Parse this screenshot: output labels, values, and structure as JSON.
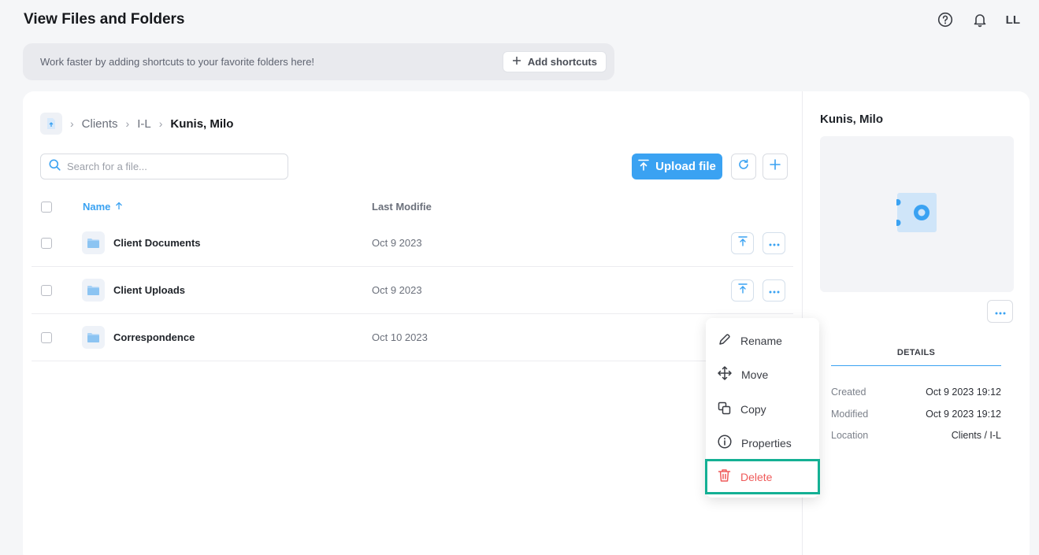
{
  "header": {
    "title": "View Files and Folders",
    "user_initials": "LL",
    "help_icon": "help-circle-icon",
    "bell_icon": "bell-icon"
  },
  "shortcuts": {
    "message": "Work faster by adding shortcuts to your favorite folders here!",
    "button_label": "Add shortcuts"
  },
  "breadcrumb": {
    "items": [
      "Clients",
      "I-L"
    ],
    "current": "Kunis, Milo"
  },
  "search": {
    "placeholder": "Search for a file..."
  },
  "toolbar": {
    "upload_label": "Upload file"
  },
  "table": {
    "columns": {
      "name": "Name",
      "modified": "Last Modifie"
    },
    "rows": [
      {
        "name": "Client Documents",
        "modified": "Oct 9 2023"
      },
      {
        "name": "Client Uploads",
        "modified": "Oct 9 2023"
      },
      {
        "name": "Correspondence",
        "modified": "Oct 10 2023"
      }
    ]
  },
  "context_menu": {
    "items": [
      {
        "label": "Rename",
        "icon": "pencil-icon"
      },
      {
        "label": "Move",
        "icon": "move-arrows-icon"
      },
      {
        "label": "Copy",
        "icon": "copy-icon"
      },
      {
        "label": "Properties",
        "icon": "info-icon"
      },
      {
        "label": "Delete",
        "icon": "trash-icon"
      }
    ]
  },
  "details_panel": {
    "title": "Kunis, Milo",
    "tab_label": "DETAILS",
    "meta": [
      {
        "key": "Created",
        "value": "Oct 9 2023 19:12"
      },
      {
        "key": "Modified",
        "value": "Oct 9 2023 19:12"
      },
      {
        "key": "Location",
        "value": "Clients / I-L"
      }
    ]
  },
  "colors": {
    "accent": "#3aa2f2",
    "danger": "#ef5a5a",
    "highlight": "#14b094"
  }
}
